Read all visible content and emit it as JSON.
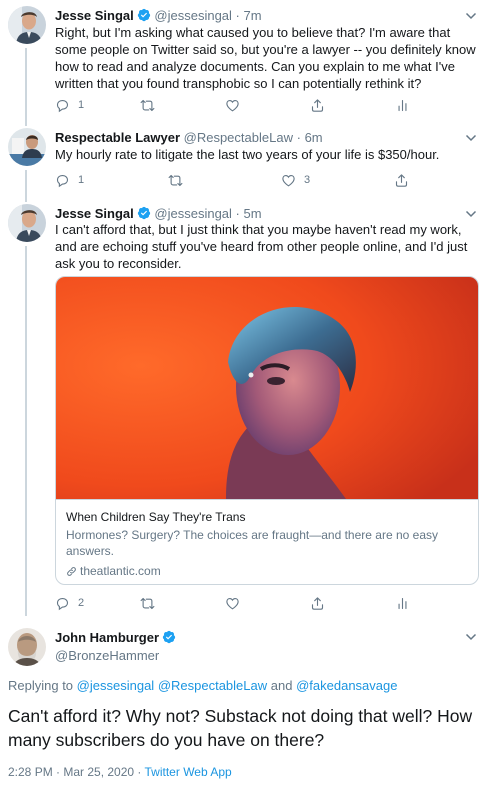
{
  "tweets": [
    {
      "name": "Jesse Singal",
      "handle": "@jessesingal",
      "time": "7m",
      "text": "Right, but I'm asking what caused you to believe that? I'm aware that some people on Twitter said so, but you're a lawyer -- you definitely know how to read and analyze documents. Can you explain to me what I've written that you found transphobic so I can potentially rethink it?",
      "reply_count": "1",
      "retweet_count": "",
      "like_count": ""
    },
    {
      "name": "Respectable Lawyer",
      "handle": "@RespectableLaw",
      "time": "6m",
      "text": "My hourly rate to litigate the last two years of your life is $350/hour.",
      "reply_count": "1",
      "retweet_count": "",
      "like_count": "3"
    },
    {
      "name": "Jesse Singal",
      "handle": "@jessesingal",
      "time": "5m",
      "text": "I can't afford that, but I just think that you maybe haven't read my work, and are echoing stuff you've heard from other people online, and I'd just ask you to reconsider.",
      "reply_count": "2",
      "retweet_count": "",
      "like_count": "",
      "card": {
        "title": "When Children Say They're Trans",
        "description": "Hormones? Surgery? The choices are fraught—and there are no easy answers.",
        "domain": "theatlantic.com"
      }
    }
  ],
  "main": {
    "name": "John Hamburger",
    "handle": "@BronzeHammer",
    "replying_prefix": "Replying to",
    "mention1": "@jessesingal",
    "mention2": "@RespectableLaw",
    "and": "and",
    "mention3": "@fakedansavage",
    "text": "Can't afford it? Why not? Substack not doing that well? How many subscribers do you have on there?",
    "timestamp": "2:28 PM · Mar 25, 2020 · ",
    "app": "Twitter Web App"
  },
  "common": {
    "dot": "·"
  },
  "icons": [
    "verified-icon",
    "caret-down-icon",
    "reply-icon",
    "retweet-icon",
    "like-icon",
    "share-icon",
    "analytics-icon",
    "link-icon"
  ],
  "colors": {
    "accent": "#1b95e0",
    "verified": "#1da1f2",
    "secondary_text": "#657786",
    "border": "#ccd6dd"
  }
}
